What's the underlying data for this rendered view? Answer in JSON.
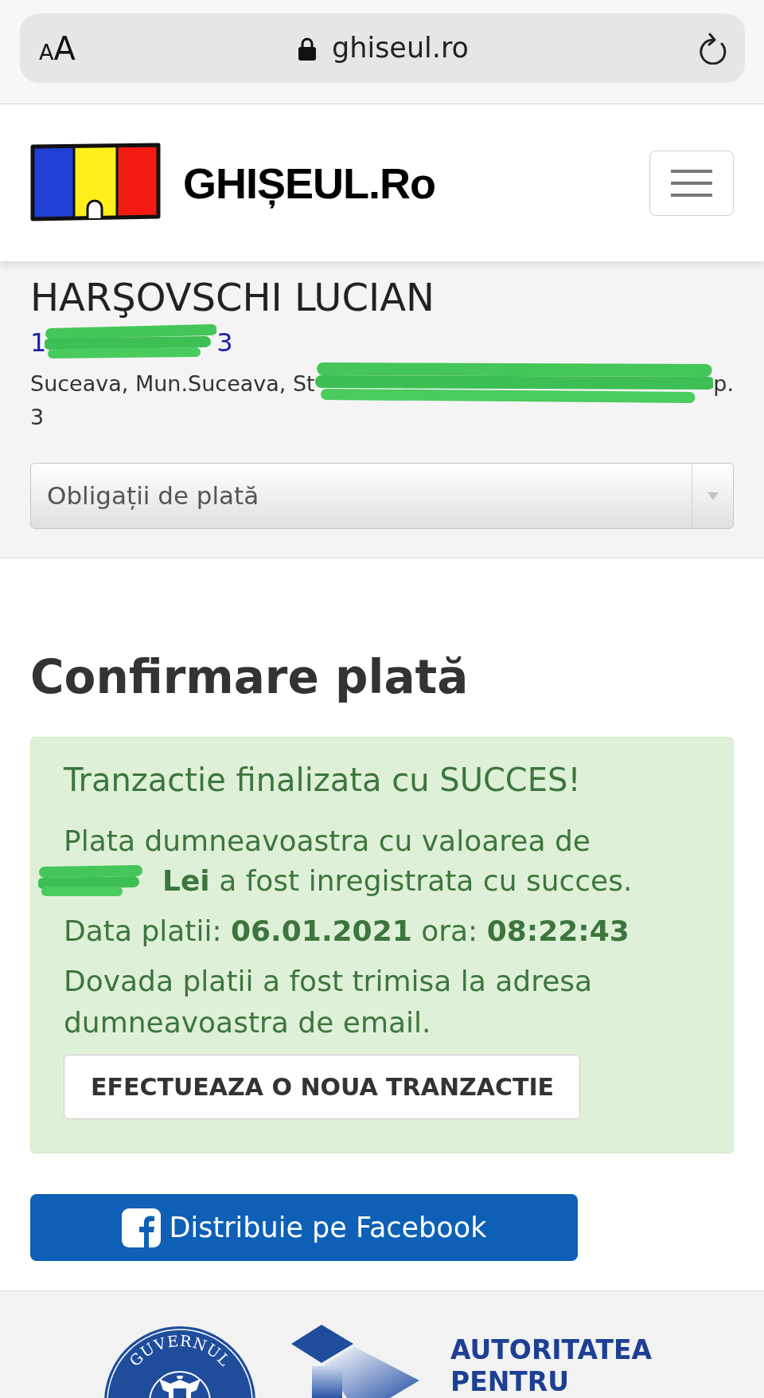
{
  "browser_bar": {
    "text_size_button": "AA",
    "url": "ghiseul.ro"
  },
  "header": {
    "logo_text": "GHIȘEUL.Ro"
  },
  "account": {
    "name": "HARŞOVSCHI LUCIAN",
    "id_start": "1",
    "id_end": "3",
    "address_start": "Suceava, Mun.Suceava, St",
    "address_end": "p.",
    "address_line_2": "3"
  },
  "obligations_select": {
    "value": "Obligații de plată"
  },
  "page_title": "Confirmare plată",
  "success_alert": {
    "title": "Tranzactie finalizata cu SUCCES!",
    "amount_line": "Plata dumneavoastra cu valoarea de",
    "amount_tail": "**Lei** a fost inregistrata cu succes.",
    "date_line": "Data platii: **06.01.2021** ora: **08:22:43**",
    "email_note": "Dovada platii a fost trimisa la adresa dumneavoastra de email.",
    "button": "EFECTUEAZA O NOUA TRANZACTIE"
  },
  "share_button": "Distribuie pe Facebook",
  "footer": {
    "seal_text": "GUVERNUL",
    "authority_lines": [
      "AUTORITATEA",
      "PENTRU"
    ]
  }
}
